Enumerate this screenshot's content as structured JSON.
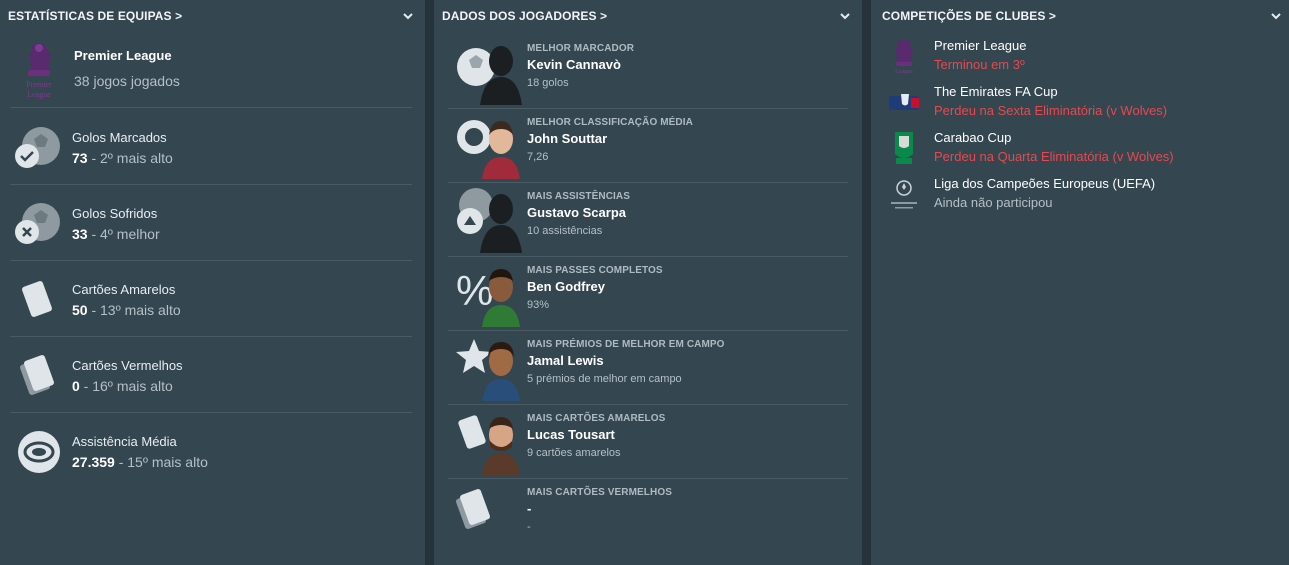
{
  "panels": {
    "team_stats": {
      "title": "ESTATÍSTICAS DE EQUIPAS >",
      "league": {
        "name": "Premier League",
        "sub": "38 jogos jogados",
        "logo_icon": "premier-league-logo"
      },
      "stats": [
        {
          "label": "Golos Marcados",
          "value": "73",
          "rank": " - 2º mais alto",
          "icon": "ball-check-icon"
        },
        {
          "label": "Golos Sofridos",
          "value": "33",
          "rank": " - 4º melhor",
          "icon": "ball-cross-icon"
        },
        {
          "label": "Cartões Amarelos",
          "value": "50",
          "rank": " - 13º mais alto",
          "icon": "yellow-card-icon"
        },
        {
          "label": "Cartões Vermelhos",
          "value": "0",
          "rank": " - 16º mais alto",
          "icon": "red-card-icon"
        },
        {
          "label": "Assistência Média",
          "value": "27.359",
          "rank": " - 15º mais alto",
          "icon": "stadium-icon"
        }
      ]
    },
    "player_data": {
      "title": "DADOS DOS JOGADORES >",
      "players": [
        {
          "category": "MELHOR MARCADOR",
          "name": "Kevin Cannavò",
          "value": "18 golos",
          "icon": "ball-silhouette-icon"
        },
        {
          "category": "MELHOR CLASSIFICAÇÃO MÉDIA",
          "name": "John Souttar",
          "value": "7,26",
          "icon": "rating-badge-icon"
        },
        {
          "category": "MAIS ASSISTÊNCIAS",
          "name": "Gustavo Scarpa",
          "value": "10 assistências",
          "icon": "assist-icon"
        },
        {
          "category": "MAIS PASSES COMPLETOS",
          "name": "Ben Godfrey",
          "value": "93%",
          "icon": "percent-icon"
        },
        {
          "category": "MAIS PRÉMIOS DE MELHOR EM CAMPO",
          "name": "Jamal Lewis",
          "value": "5 prémios de melhor em campo",
          "icon": "star-icon"
        },
        {
          "category": "MAIS CARTÕES AMARELOS",
          "name": "Lucas Tousart",
          "value": "9 cartões amarelos",
          "icon": "yellow-card-icon"
        },
        {
          "category": "MAIS CARTÕES VERMELHOS",
          "name": "-",
          "value": "-",
          "icon": "red-card-icon"
        }
      ]
    },
    "club_competitions": {
      "title": "COMPETIÇÕES DE CLUBES >",
      "competitions": [
        {
          "name": "Premier League",
          "result": "Terminou em 3º",
          "status": "red",
          "icon": "premier-league-logo"
        },
        {
          "name": "The Emirates FA Cup",
          "result": "Perdeu na Sexta Eliminatória (v Wolves)",
          "status": "red",
          "icon": "fa-cup-logo"
        },
        {
          "name": "Carabao Cup",
          "result": "Perdeu na Quarta Eliminatória (v Wolves)",
          "status": "red",
          "icon": "carabao-cup-logo"
        },
        {
          "name": "Liga dos Campeões Europeus (UEFA)",
          "result": "Ainda não participou",
          "status": "grey",
          "icon": "champions-league-logo"
        }
      ]
    }
  },
  "colors": {
    "panel": "#34464f",
    "accent_red": "#e8484f",
    "muted": "#b4c0c6"
  }
}
